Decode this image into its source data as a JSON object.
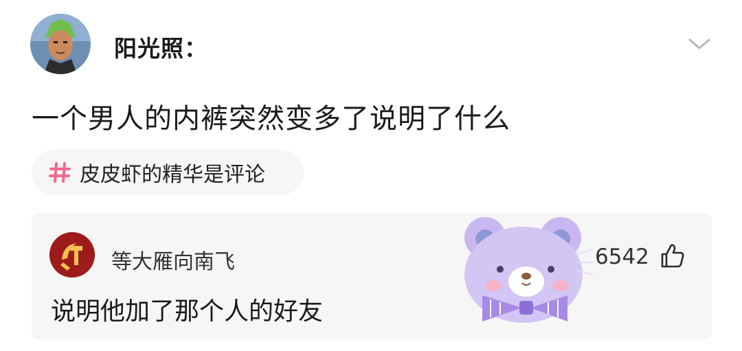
{
  "post": {
    "author": "阳光照：",
    "text": "一个男人的内裤突然变多了说明了什么"
  },
  "topic": {
    "label": "皮皮虾的精华是评论"
  },
  "top_comment": {
    "author": "等大雁向南飞",
    "text": "说明他加了那个人的好友",
    "likes": "6542"
  },
  "icons": {
    "avatar": "anime-avatar",
    "chevron": "chevron-down-icon",
    "hash": "hash-icon",
    "like": "thumbs-up-icon",
    "sticker": "purple-bear-sticker"
  },
  "colors": {
    "hash": "#f06a8f",
    "comment_avatar": "#9e1b1b",
    "sticker": "#c9b8f0"
  }
}
